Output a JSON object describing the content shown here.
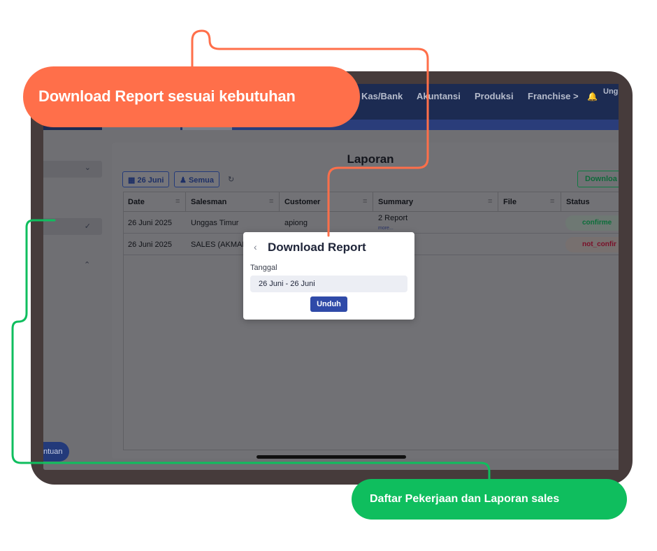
{
  "navbar": {
    "items": [
      "Kas/Bank",
      "Akuntansi",
      "Produksi",
      "Franchise >"
    ],
    "user_label": "Ung"
  },
  "sidebar": {
    "help_label": "ntuan"
  },
  "page": {
    "title": "Laporan",
    "filter_date": "26 Juni",
    "filter_user": "Semua",
    "download_label": "Downloa"
  },
  "table": {
    "columns": [
      "Date",
      "Salesman",
      "Customer",
      "Summary",
      "File",
      "Status"
    ],
    "rows": [
      {
        "date": "26 Juni 2025",
        "salesman": "Unggas Timur",
        "customer": "apiong",
        "summary": "2 Report",
        "summary_more": "more...",
        "file": "",
        "status": "confirme"
      },
      {
        "date": "26 Juni 2025",
        "salesman": "SALES (AKMAL",
        "customer": "",
        "summary": "",
        "summary_more": "",
        "file": "",
        "status": "not_confir"
      }
    ]
  },
  "modal": {
    "title": "Download Report",
    "field_label": "Tanggal",
    "field_value": "26 Juni - 26 Juni",
    "submit_label": "Unduh"
  },
  "callouts": {
    "top": "Download Report sesuai kebutuhan",
    "bottom": "Daftar Pekerjaan dan Laporan sales"
  },
  "colors": {
    "orange": "#ff6f4a",
    "green": "#0fbe5e",
    "primary": "#2f4aa8",
    "tablet": "#463b3b"
  },
  "icons": {
    "calendar": "calendar-icon",
    "user": "user-icon",
    "refresh": "refresh-icon",
    "bell": "bell-icon",
    "back": "chevron-left-icon"
  }
}
